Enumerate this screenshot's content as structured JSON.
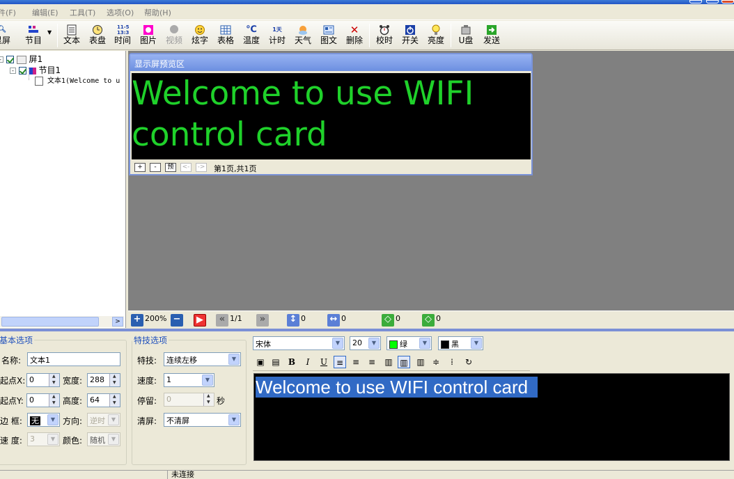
{
  "menu": [
    "文件(F)",
    "编辑(E)",
    "工具(T)",
    "选项(O)",
    "帮助(H)"
  ],
  "toolbar": [
    {
      "label": "显屏",
      "icon": "magnifier-icon"
    },
    {
      "label": "节目",
      "icon": "program-icon"
    },
    {
      "label": "文本",
      "icon": "text-icon"
    },
    {
      "label": "表盘",
      "icon": "clock-icon"
    },
    {
      "label": "时间",
      "icon": "time-icon",
      "glyph": "11-5\n13:3"
    },
    {
      "label": "图片",
      "icon": "picture-icon"
    },
    {
      "label": "视频",
      "icon": "video-icon"
    },
    {
      "label": "炫字",
      "icon": "smiley-icon"
    },
    {
      "label": "表格",
      "icon": "table-icon"
    },
    {
      "label": "温度",
      "icon": "temperature-icon",
      "glyph": "℃"
    },
    {
      "label": "计时",
      "icon": "countdown-icon",
      "glyph": "1天"
    },
    {
      "label": "天气",
      "icon": "weather-icon"
    },
    {
      "label": "图文",
      "icon": "image-text-icon"
    },
    {
      "label": "删除",
      "icon": "delete-icon",
      "glyph": "✕"
    },
    {
      "label": "校时",
      "icon": "alarm-clock-icon"
    },
    {
      "label": "开关",
      "icon": "power-icon"
    },
    {
      "label": "亮度",
      "icon": "bulb-icon"
    },
    {
      "label": "U盘",
      "icon": "usb-icon"
    },
    {
      "label": "发送",
      "icon": "send-icon"
    }
  ],
  "tree": {
    "screen": "屏1",
    "program": "节目1",
    "text_item": "文本1(Welcome to u"
  },
  "preview": {
    "title": "显示屏预览区",
    "line1": "Welcome to use WIFI",
    "line2": "control card",
    "page_info": "第1页,共1页",
    "btn_plus": "+",
    "btn_minus": "-",
    "btn_preview": "预",
    "btn_prev": "<-",
    "btn_next": "->"
  },
  "status_row": {
    "zoom": "200%",
    "page": "1/1",
    "v1": "0",
    "v2": "0",
    "v3": "0",
    "v4": "0"
  },
  "basic": {
    "legend": "基本选项",
    "name_label": "名称:",
    "name_value": "文本1",
    "x_label": "起点X:",
    "x_value": "0",
    "w_label": "宽度:",
    "w_value": "288",
    "y_label": "起点Y:",
    "y_value": "0",
    "h_label": "高度:",
    "h_value": "64",
    "border_label": "边 框:",
    "border_value": "无",
    "dir_label": "方向:",
    "dir_value": "逆时",
    "speed_label": "速 度:",
    "speed_value": "3",
    "color_label": "颜色:",
    "color_value": "随机"
  },
  "effects": {
    "legend": "特技选项",
    "effect_label": "特技:",
    "effect_value": "连续左移",
    "speed_label": "速度:",
    "speed_value": "1",
    "stay_label": "停留:",
    "stay_value": "0",
    "stay_unit": "秒",
    "clear_label": "清屏:",
    "clear_value": "不清屏"
  },
  "format": {
    "font": "宋体",
    "size": "20",
    "color_name": "绿",
    "color": "#00ff00",
    "bg_name": "黑",
    "bg": "#000000"
  },
  "editor_text": "Welcome to use WIFI control card",
  "statusbar": "未连接"
}
